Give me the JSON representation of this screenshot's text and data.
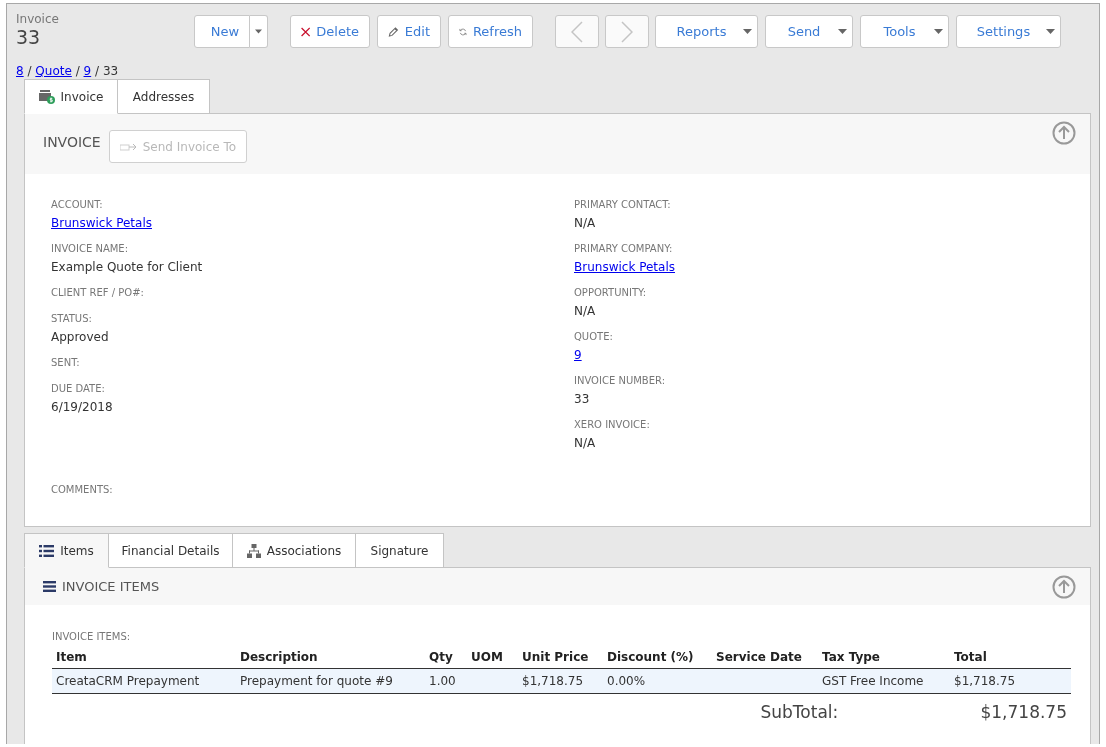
{
  "header": {
    "label": "Invoice",
    "number": "33"
  },
  "toolbar": [
    {
      "kind": "new",
      "label": "New",
      "disabled": false
    },
    {
      "kind": "delete",
      "label": "Delete",
      "disabled": false
    },
    {
      "kind": "edit",
      "label": "Edit",
      "disabled": false
    },
    {
      "kind": "refresh",
      "label": "Refresh",
      "disabled": false
    },
    {
      "kind": "prev",
      "disabled": true
    },
    {
      "kind": "next",
      "disabled": true
    },
    {
      "kind": "menu",
      "label": "Reports",
      "disabled": false
    },
    {
      "kind": "menu",
      "label": "Send",
      "disabled": false
    },
    {
      "kind": "menu",
      "label": "Tools",
      "disabled": false
    },
    {
      "kind": "menu",
      "label": "Settings",
      "disabled": false
    }
  ],
  "breadcrumb": [
    {
      "kind": "link",
      "text": "8"
    },
    {
      "kind": "separator",
      "text": "/"
    },
    {
      "kind": "link",
      "text": "Quote"
    },
    {
      "kind": "separator",
      "text": "/"
    },
    {
      "kind": "link",
      "text": "9"
    },
    {
      "kind": "separator",
      "text": "/"
    },
    {
      "kind": "current",
      "text": "33"
    }
  ],
  "detail_tabs": [
    {
      "label": "Invoice",
      "selected": true
    },
    {
      "label": "Addresses",
      "selected": false
    }
  ],
  "invoice_panel": {
    "title": "INVOICE",
    "send_button": {
      "label": "Send Invoice To",
      "disabled": true
    },
    "left_fields": [
      {
        "label": "ACCOUNT:",
        "value": "Brunswick Petals",
        "kind": "link"
      },
      {
        "label": "INVOICE NAME:",
        "value": "Example Quote for Client",
        "kind": "text"
      },
      {
        "label": "CLIENT REF / PO#:"
      },
      {
        "label": "STATUS:",
        "value": "Approved",
        "kind": "text"
      },
      {
        "label": "SENT:"
      },
      {
        "label": "DUE DATE:",
        "value": "6/19/2018",
        "kind": "text"
      }
    ],
    "right_fields": [
      {
        "label": "PRIMARY CONTACT:",
        "value": "N/A",
        "kind": "text"
      },
      {
        "label": "PRIMARY COMPANY:",
        "value": "Brunswick Petals",
        "kind": "link"
      },
      {
        "label": "OPPORTUNITY:",
        "value": "N/A",
        "kind": "text"
      },
      {
        "label": "QUOTE:",
        "value": "9",
        "kind": "link"
      },
      {
        "label": "INVOICE NUMBER:",
        "value": "33",
        "kind": "text"
      },
      {
        "label": "XERO INVOICE:",
        "value": "N/A",
        "kind": "text"
      }
    ],
    "comments": {
      "label": "COMMENTS:"
    }
  },
  "item_tabs": [
    {
      "label": "Items",
      "selected": true
    },
    {
      "label": "Financial Details",
      "selected": false
    },
    {
      "label": "Associations",
      "selected": false
    },
    {
      "label": "Signature",
      "selected": false
    }
  ],
  "items_panel": {
    "title": "INVOICE ITEMS",
    "table_label": "INVOICE ITEMS:",
    "table": {
      "columns": [
        "Item",
        "Description",
        "Qty",
        "UOM",
        "Unit Price",
        "Discount (%)",
        "Service Date",
        "Tax Type",
        "Total"
      ],
      "rows": [
        [
          "CreataCRM Prepayment",
          "Prepayment for quote #9",
          "1.00",
          "",
          "$1,718.75",
          "0.00%",
          "",
          "GST Free Income",
          "$1,718.75"
        ]
      ]
    },
    "subtotal": {
      "label": "SubTotal:",
      "value": "$1,718.75"
    }
  }
}
